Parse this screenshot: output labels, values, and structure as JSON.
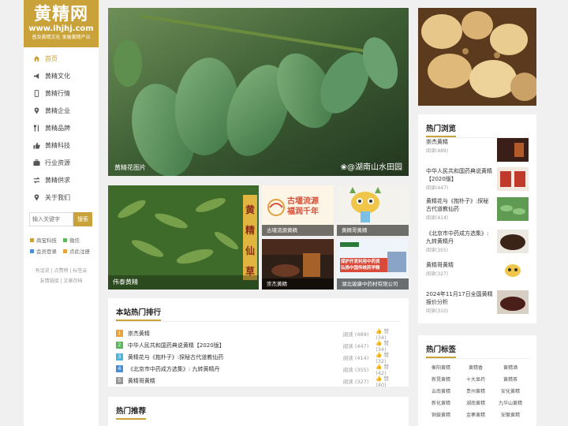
{
  "logo": {
    "name": "黄精网",
    "url": "www.ihjhj.com",
    "slogan": "普及黄精文化 发展黄精产业"
  },
  "nav": [
    {
      "label": "首页",
      "icon": "home-icon",
      "active": true
    },
    {
      "label": "黄精文化",
      "icon": "megaphone-icon"
    },
    {
      "label": "黄精行情",
      "icon": "phone-icon"
    },
    {
      "label": "黄精企业",
      "icon": "location-pin-icon"
    },
    {
      "label": "黄精品牌",
      "icon": "utensils-icon"
    },
    {
      "label": "黄精科技",
      "icon": "thumbs-up-icon"
    },
    {
      "label": "行业资源",
      "icon": "briefcase-icon"
    },
    {
      "label": "黄精供求",
      "icon": "transfer-icon"
    },
    {
      "label": "关于我们",
      "icon": "location-pin-icon"
    }
  ],
  "search": {
    "placeholder": "输入关键字",
    "button": "搜索"
  },
  "quick_links": [
    {
      "label": "商宝科技",
      "color": "#c9a23a"
    },
    {
      "label": "微信",
      "color": "#5cb85c"
    },
    {
      "label": "会员登录",
      "color": "#4a90d9"
    },
    {
      "label": "点此注册",
      "color": "#e8a33c"
    }
  ],
  "footer_links": [
    "有话说 | 点赞榜 | 标签云",
    "友情链接 | 文章存档"
  ],
  "slider": {
    "caption": "黄精花图片",
    "watermark": "❀@湖南山水田园"
  },
  "grid": [
    {
      "caption": "伟泰黄精"
    },
    {
      "caption": "古堰流源黄精",
      "overlay": "古堰流源\n福润千年"
    },
    {
      "caption": "黄精哥黄精"
    },
    {
      "caption": "崇杰黄精"
    },
    {
      "caption": "湖北骏康中药材有限公司",
      "overlay": "保护开发利用中药资\n弘扬中国传统药学精"
    }
  ],
  "vertical_banner": [
    "黄",
    "精",
    "仙",
    "草"
  ],
  "ranking": {
    "title": "本站热门排行",
    "rows": [
      {
        "num": "1",
        "title": "崇杰黄精",
        "views": "阅读 (489)",
        "likes": "赞 (34)",
        "color": "#e8a33c"
      },
      {
        "num": "2",
        "title": "中华人民共和国药典说黄精【2020版】",
        "views": "阅读 (447)",
        "likes": "赞 (34)",
        "color": "#5cb85c"
      },
      {
        "num": "3",
        "title": "黄精花与《抱朴子》:探秘古代道教仙药",
        "views": "阅读 (414)",
        "likes": "赞 (32)",
        "color": "#4ab8d9"
      },
      {
        "num": "4",
        "title": "《北京市中药成方选集》: 九转黄精丹",
        "views": "阅读 (355)",
        "likes": "赞 (42)",
        "color": "#4a90d9"
      },
      {
        "num": "5",
        "title": "黄精哥黄精",
        "views": "阅读 (327)",
        "likes": "赞 (40)",
        "color": "#999999"
      }
    ]
  },
  "recommend": {
    "title": "热门推荐"
  },
  "hot_browse": {
    "title": "热门浏览",
    "items": [
      {
        "title": "崇杰黄精",
        "views": "阅读(489)"
      },
      {
        "title": "中华人民共和国药典说黄精【2020版】",
        "views": "阅读(447)"
      },
      {
        "title": "黄精花与《抱朴子》:探秘古代道教仙药",
        "views": "阅读(414)"
      },
      {
        "title": "《北京市中药成方选集》: 九转黄精丹",
        "views": "阅读(355)"
      },
      {
        "title": "黄精哥黄精",
        "views": "阅读(327)"
      },
      {
        "title": "2024年11月17日全国黄精报价分析",
        "views": "阅读(310)"
      }
    ]
  },
  "hot_tags": {
    "title": "热门标签",
    "tags": [
      "衡阳黄精",
      "黄精香",
      "黄精酒",
      "新晃黄精",
      "十大显药",
      "黄精茶",
      "云南黄精",
      "贵州黄精",
      "安化黄精",
      "新化黄精",
      "湖南黄精",
      "九华山黄精",
      "铜鼓黄精",
      "金寨黄精",
      "安徽黄精"
    ]
  },
  "colors": {
    "accent": "#c9a23a"
  }
}
